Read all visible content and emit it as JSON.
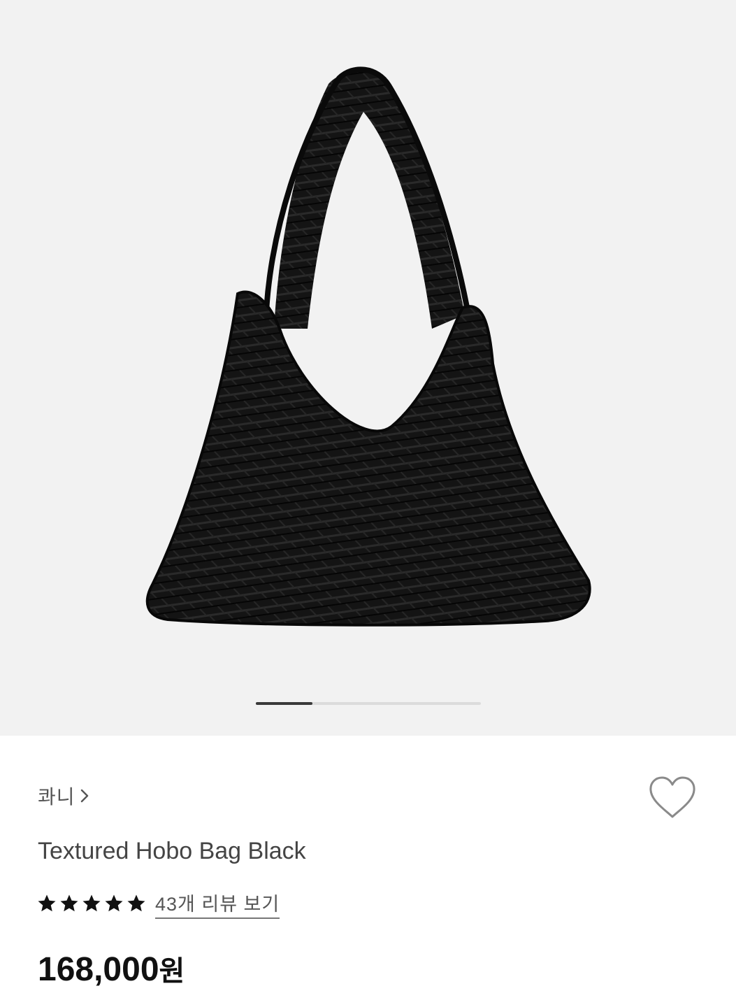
{
  "gallery": {
    "image_alt": "product-photo-black-hobo-bag",
    "progress_fraction": 0.25
  },
  "product": {
    "brand": "콰니",
    "title": "Textured Hobo Bag Black",
    "rating_stars": 5,
    "review_link": "43개 리뷰 보기",
    "price_amount": "168,000",
    "price_currency": "원"
  },
  "icons": {
    "brand_chevron": "chevron-right-icon",
    "wishlist": "heart-outline-icon",
    "star": "star-filled-icon"
  },
  "colors": {
    "hero_background": "#f2f2f2",
    "progress_track": "#dcdcdc",
    "progress_fill": "#3a3a3a",
    "star": "#111111",
    "heart_stroke": "#8a8a8a"
  }
}
